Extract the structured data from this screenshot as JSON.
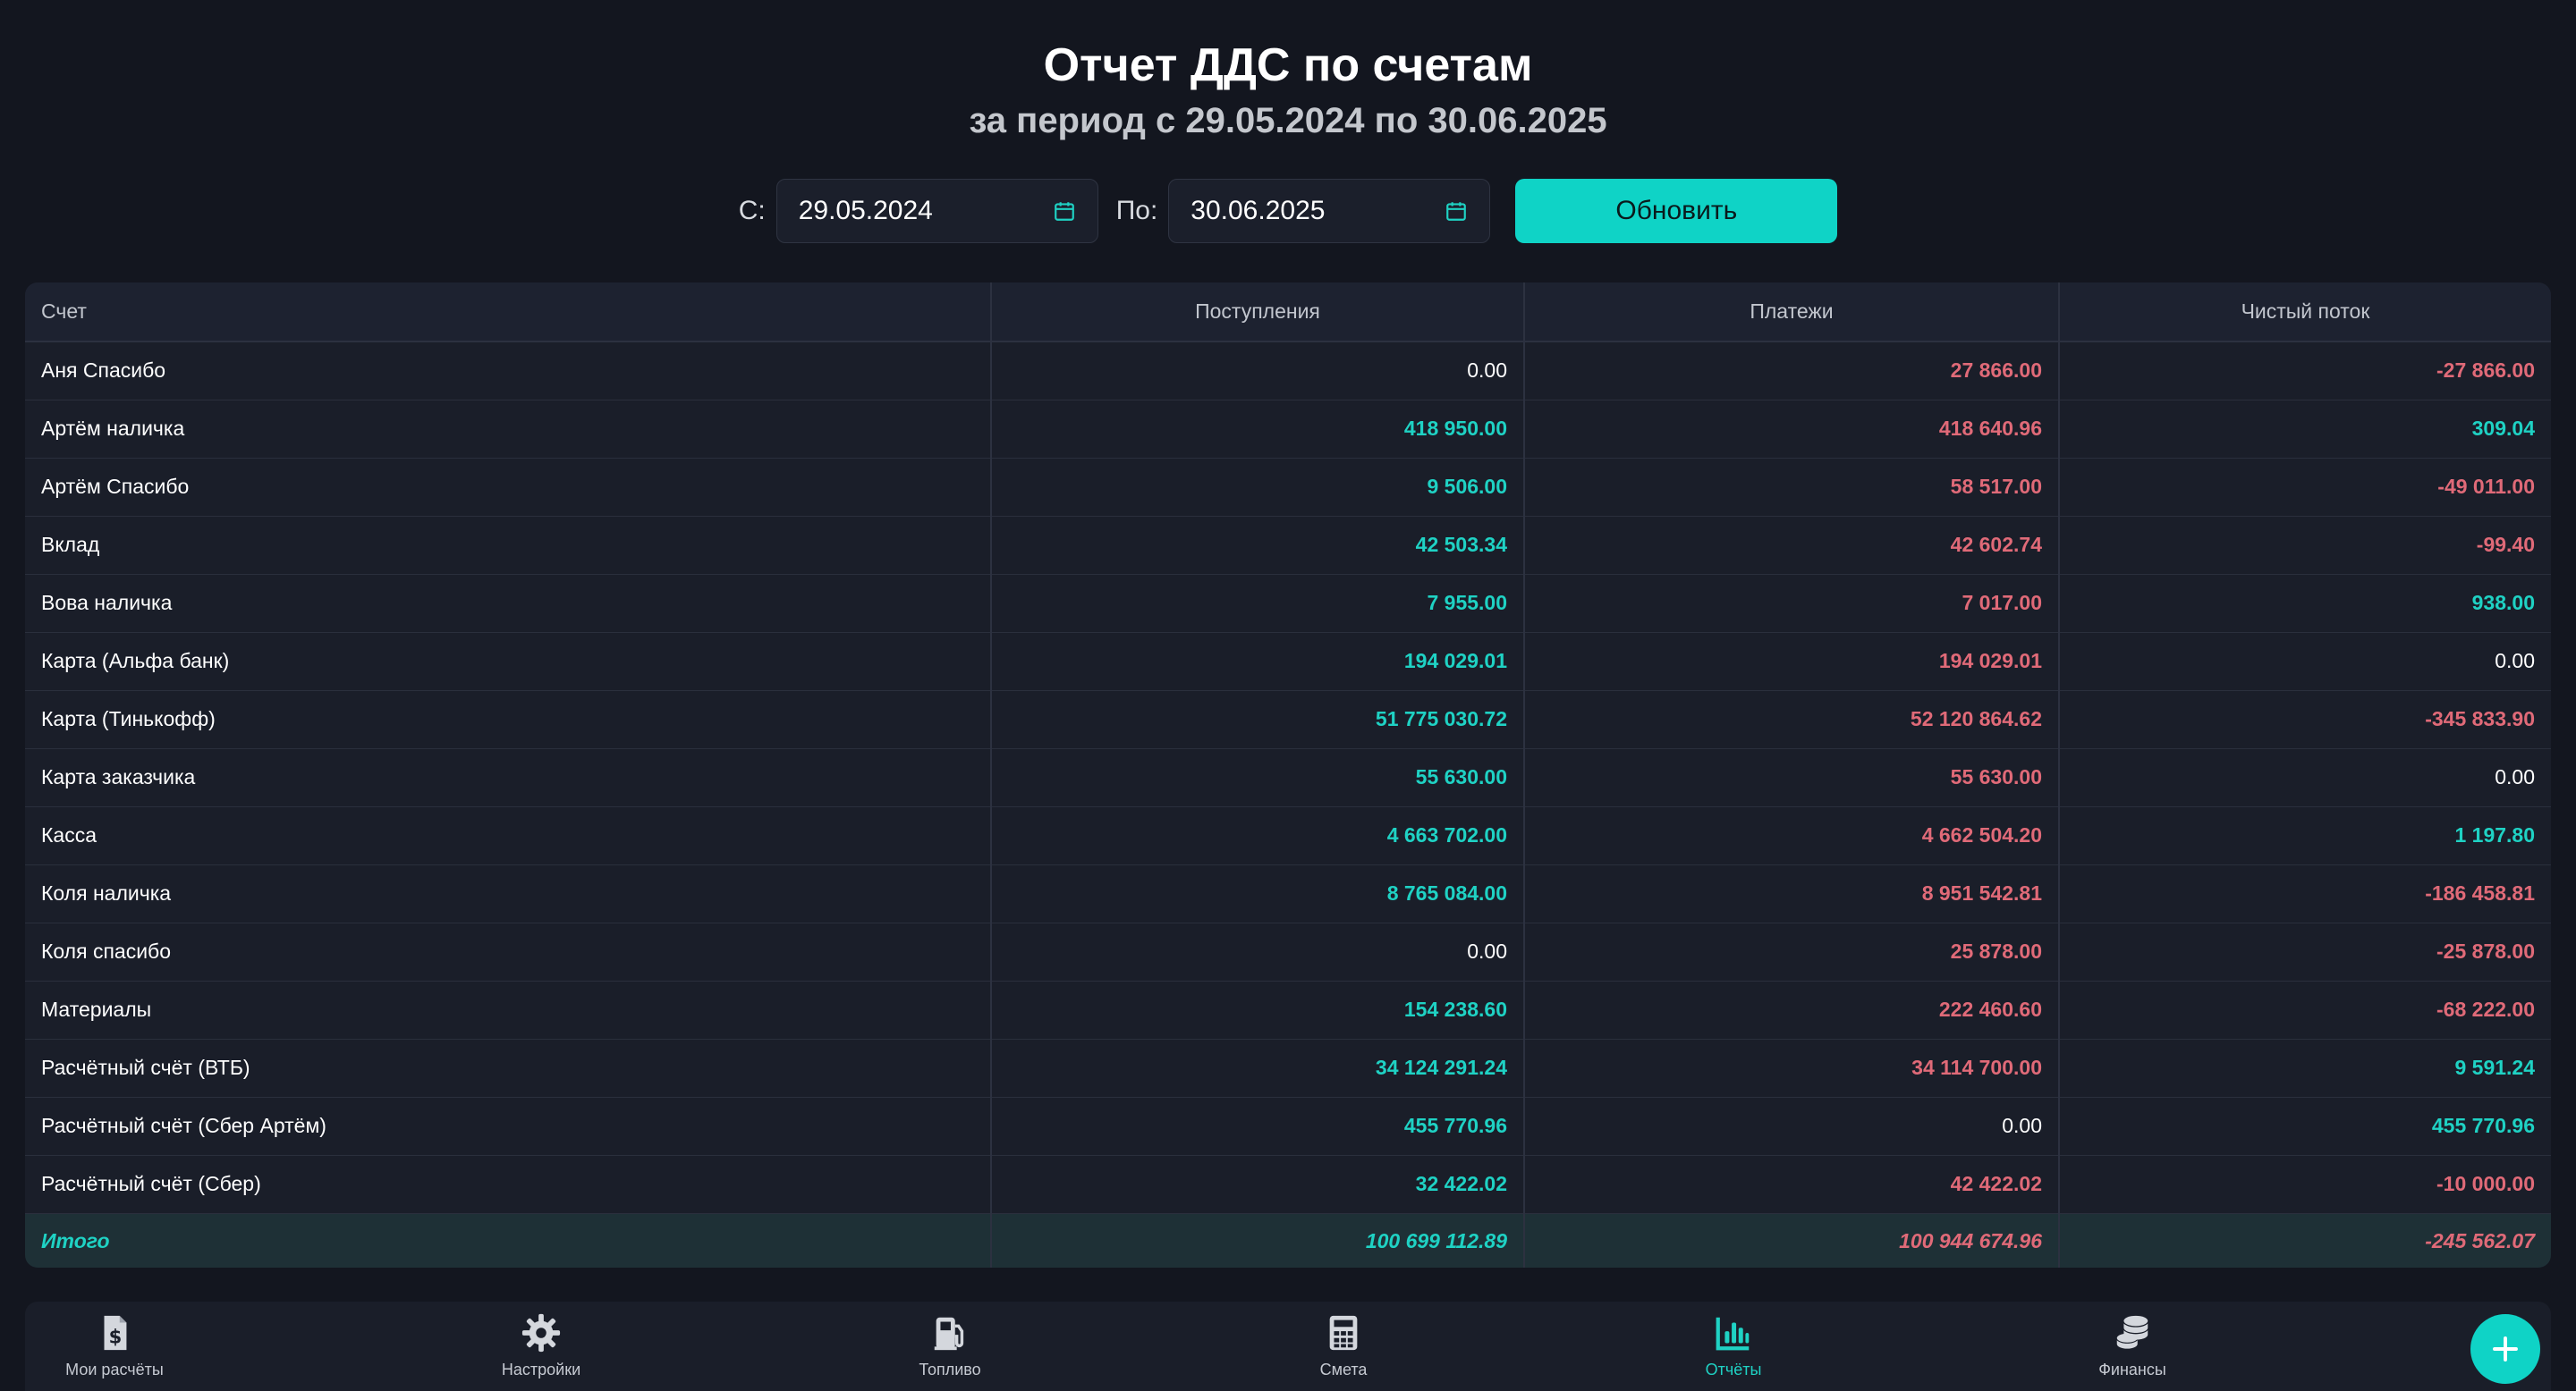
{
  "header": {
    "title": "Отчет ДДС по счетам",
    "subtitle": "за период с 29.05.2024 по 30.06.2025"
  },
  "filters": {
    "from_label": "С:",
    "from_value": "29.05.2024",
    "to_label": "По:",
    "to_value": "30.06.2025",
    "refresh_label": "Обновить"
  },
  "table": {
    "columns": [
      "Счет",
      "Поступления",
      "Платежи",
      "Чистый поток"
    ],
    "rows": [
      {
        "name": "Аня Спасибо",
        "income": "0.00",
        "payments": "27 866.00",
        "net": "-27 866.00"
      },
      {
        "name": "Артём наличка",
        "income": "418 950.00",
        "payments": "418 640.96",
        "net": "309.04"
      },
      {
        "name": "Артём Спасибо",
        "income": "9 506.00",
        "payments": "58 517.00",
        "net": "-49 011.00"
      },
      {
        "name": "Вклад",
        "income": "42 503.34",
        "payments": "42 602.74",
        "net": "-99.40"
      },
      {
        "name": "Вова наличка",
        "income": "7 955.00",
        "payments": "7 017.00",
        "net": "938.00"
      },
      {
        "name": "Карта (Альфа банк)",
        "income": "194 029.01",
        "payments": "194 029.01",
        "net": "0.00"
      },
      {
        "name": "Карта (Тинькофф)",
        "income": "51 775 030.72",
        "payments": "52 120 864.62",
        "net": "-345 833.90"
      },
      {
        "name": "Карта заказчика",
        "income": "55 630.00",
        "payments": "55 630.00",
        "net": "0.00"
      },
      {
        "name": "Касса",
        "income": "4 663 702.00",
        "payments": "4 662 504.20",
        "net": "1 197.80"
      },
      {
        "name": "Коля наличка",
        "income": "8 765 084.00",
        "payments": "8 951 542.81",
        "net": "-186 458.81"
      },
      {
        "name": "Коля спасибо",
        "income": "0.00",
        "payments": "25 878.00",
        "net": "-25 878.00"
      },
      {
        "name": "Материалы",
        "income": "154 238.60",
        "payments": "222 460.60",
        "net": "-68 222.00"
      },
      {
        "name": "Расчётный счёт (ВТБ)",
        "income": "34 124 291.24",
        "payments": "34 114 700.00",
        "net": "9 591.24"
      },
      {
        "name": "Расчётный счёт (Сбер Артём)",
        "income": "455 770.96",
        "payments": "0.00",
        "net": "455 770.96"
      },
      {
        "name": "Расчётный счёт (Сбер)",
        "income": "32 422.02",
        "payments": "42 422.02",
        "net": "-10 000.00"
      }
    ],
    "total": {
      "name": "Итого",
      "income": "100 699 112.89",
      "payments": "100 944 674.96",
      "net": "-245 562.07"
    }
  },
  "nav": {
    "items": [
      {
        "label": "Мои расчёты",
        "icon": "invoice-dollar-icon"
      },
      {
        "label": "Настройки",
        "icon": "gear-icon"
      },
      {
        "label": "Топливо",
        "icon": "fuel-pump-icon"
      },
      {
        "label": "Смета",
        "icon": "calculator-icon"
      },
      {
        "label": "Отчёты",
        "icon": "bar-chart-icon",
        "active": true
      },
      {
        "label": "Финансы",
        "icon": "coins-icon"
      }
    ]
  },
  "colors": {
    "accent": "#0fd3c6",
    "positive": "#1fd2c4",
    "negative": "#e06a78",
    "background": "#13161f"
  }
}
